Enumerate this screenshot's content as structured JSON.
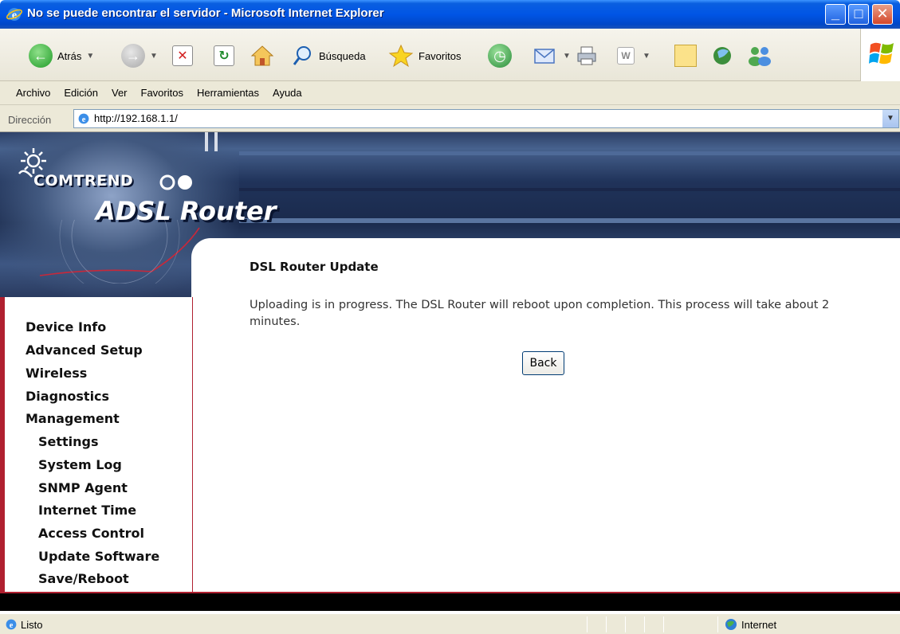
{
  "window": {
    "title": "No se puede encontrar el servidor - Microsoft Internet Explorer"
  },
  "toolbar": {
    "back_label": "Atrás",
    "search_label": "Búsqueda",
    "favorites_label": "Favoritos"
  },
  "menu": {
    "items": [
      "Archivo",
      "Edición",
      "Ver",
      "Favoritos",
      "Herramientas",
      "Ayuda"
    ]
  },
  "address": {
    "label": "Dirección",
    "url": "http://192.168.1.1/"
  },
  "banner": {
    "brand": "COMTREND",
    "product": "ADSL Router"
  },
  "sidebar": {
    "items": [
      "Device Info",
      "Advanced Setup",
      "Wireless",
      "Diagnostics",
      "Management",
      "Settings",
      "System Log",
      "SNMP Agent",
      "Internet Time",
      "Access Control",
      "Update Software",
      "Save/Reboot"
    ]
  },
  "main": {
    "title": "DSL Router Update",
    "message": "Uploading is in progress. The DSL Router will reboot upon completion. This process will take about 2 minutes.",
    "back_button": "Back"
  },
  "status": {
    "text": "Listo",
    "zone": "Internet"
  },
  "colors": {
    "titlebar": "#0055e5",
    "sidebar_border": "#b02030",
    "banner": "#20335a"
  }
}
